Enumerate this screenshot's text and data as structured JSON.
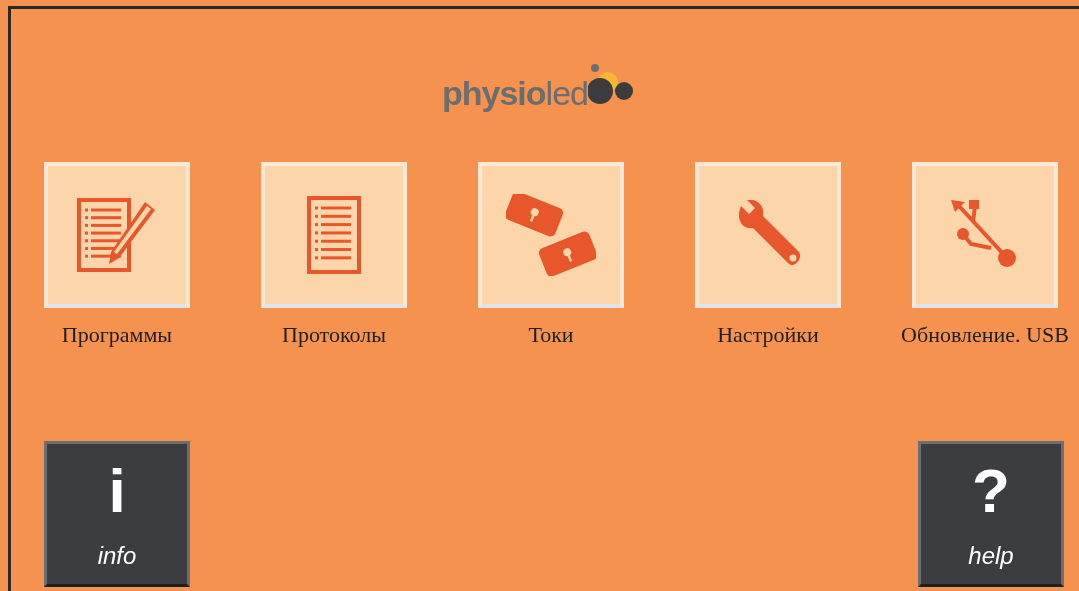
{
  "logo": {
    "bold": "physio",
    "light": "led"
  },
  "tiles": [
    {
      "kind": "programs",
      "label": "Программы"
    },
    {
      "kind": "protocols",
      "label": "Протоколы"
    },
    {
      "kind": "currents",
      "label": "Токи"
    },
    {
      "kind": "settings",
      "label": "Настройки"
    },
    {
      "kind": "usb",
      "label": "Обновление. USB"
    }
  ],
  "bottom_buttons": [
    {
      "symbol": "i",
      "label": "info"
    },
    {
      "symbol": "?",
      "label": "help"
    }
  ]
}
